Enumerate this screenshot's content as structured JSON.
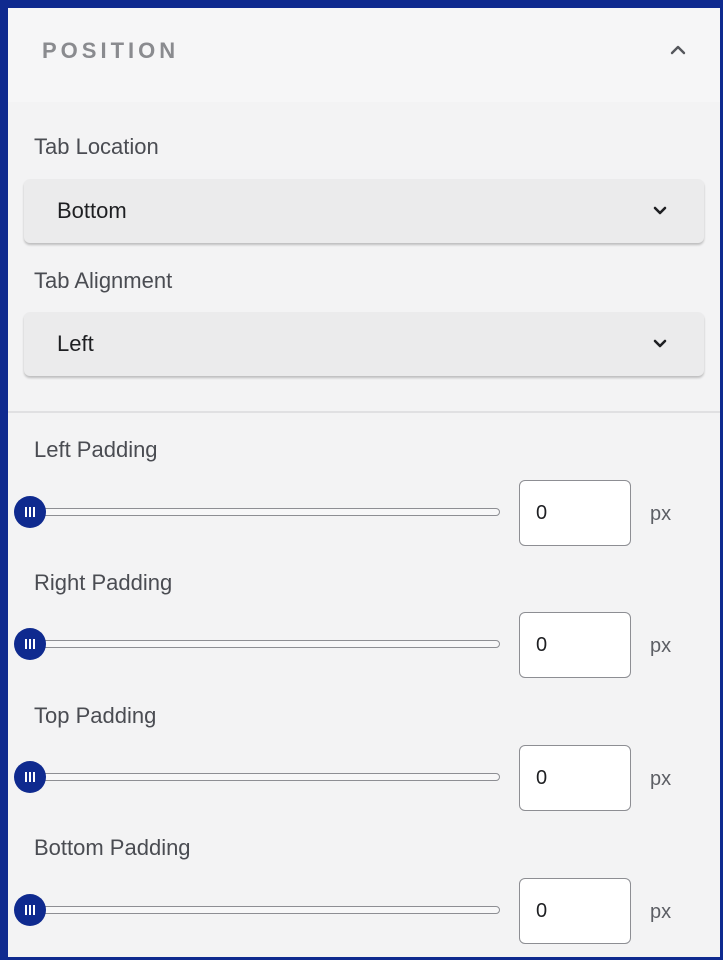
{
  "section": {
    "title": "POSITION",
    "collapse_icon": "chevron-up-icon"
  },
  "tab_location": {
    "label": "Tab Location",
    "value": "Bottom",
    "icon": "chevron-down-icon"
  },
  "tab_alignment": {
    "label": "Tab Alignment",
    "value": "Left",
    "icon": "chevron-down-icon"
  },
  "paddings": {
    "left": {
      "label": "Left Padding",
      "value": "0",
      "unit": "px",
      "slider_percent": 0
    },
    "right": {
      "label": "Right Padding",
      "value": "0",
      "unit": "px",
      "slider_percent": 0
    },
    "top": {
      "label": "Top Padding",
      "value": "0",
      "unit": "px",
      "slider_percent": 0
    },
    "bottom": {
      "label": "Bottom Padding",
      "value": "0",
      "unit": "px",
      "slider_percent": 0
    }
  },
  "colors": {
    "accent": "#0f2a8f",
    "panel_background": "#f3f3f4",
    "select_background": "#ebebec",
    "label_text": "#4a4c52",
    "header_text": "#8a8b8f"
  }
}
